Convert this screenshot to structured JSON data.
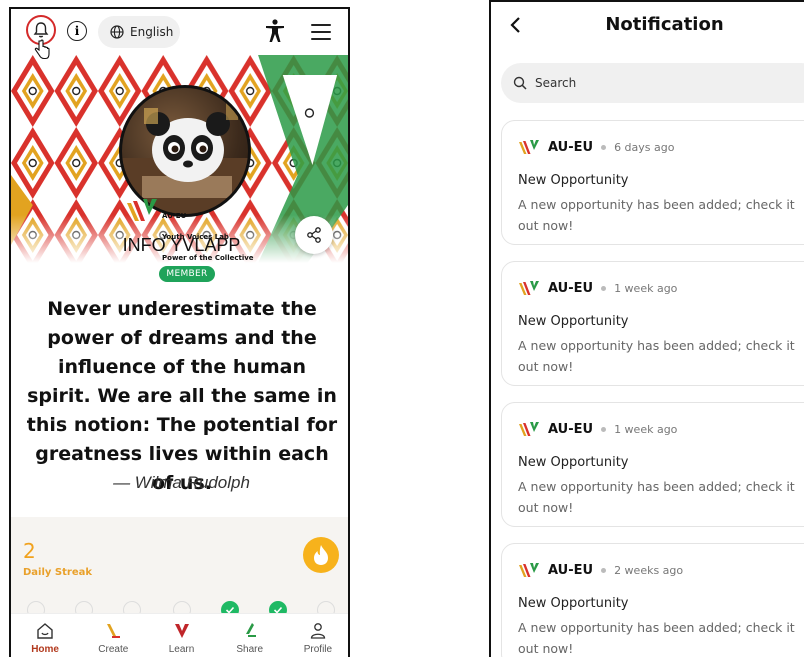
{
  "left_screen": {
    "topbar": {
      "language_label": "English"
    },
    "profile": {
      "username": "INFO YVLAPP",
      "badge": "MEMBER",
      "logo_lines": [
        "AU-EU",
        "Youth Voices Lab",
        "Power of the Collective"
      ]
    },
    "quote": {
      "text": "Never underestimate the power of dreams and the influence of the human spirit. We are all the same in this notion: The potential for greatness lives within each of us.",
      "author": "— Wilma Rudolph"
    },
    "streak": {
      "count": "2",
      "label": "Daily Streak",
      "days": [
        false,
        false,
        false,
        false,
        true,
        true,
        false
      ]
    },
    "bottom_nav": [
      {
        "label": "Home",
        "icon": "home-icon",
        "active": true
      },
      {
        "label": "Create",
        "icon": "create-icon",
        "active": false
      },
      {
        "label": "Learn",
        "icon": "learn-icon",
        "active": false
      },
      {
        "label": "Share",
        "icon": "share-icon",
        "active": false
      },
      {
        "label": "Profile",
        "icon": "profile-icon",
        "active": false
      }
    ]
  },
  "right_screen": {
    "title": "Notification",
    "search_placeholder": "Search",
    "notifications": [
      {
        "source": "AU-EU",
        "time": "6 days ago",
        "title": "New Opportunity",
        "body": "A new opportunity has been added; check it out now!"
      },
      {
        "source": "AU-EU",
        "time": "1 week ago",
        "title": "New Opportunity",
        "body": "A new opportunity has been added; check it out now!"
      },
      {
        "source": "AU-EU",
        "time": "1 week ago",
        "title": "New Opportunity",
        "body": "A new opportunity has been added; check it out now!"
      },
      {
        "source": "AU-EU",
        "time": "2 weeks ago",
        "title": "New Opportunity",
        "body": "A new opportunity has been added; check it out now!"
      }
    ]
  },
  "colors": {
    "accent_red": "#d42a2a",
    "member_green": "#1fa35a",
    "streak_orange": "#f1a21e",
    "nav_active": "#b23a1e"
  }
}
